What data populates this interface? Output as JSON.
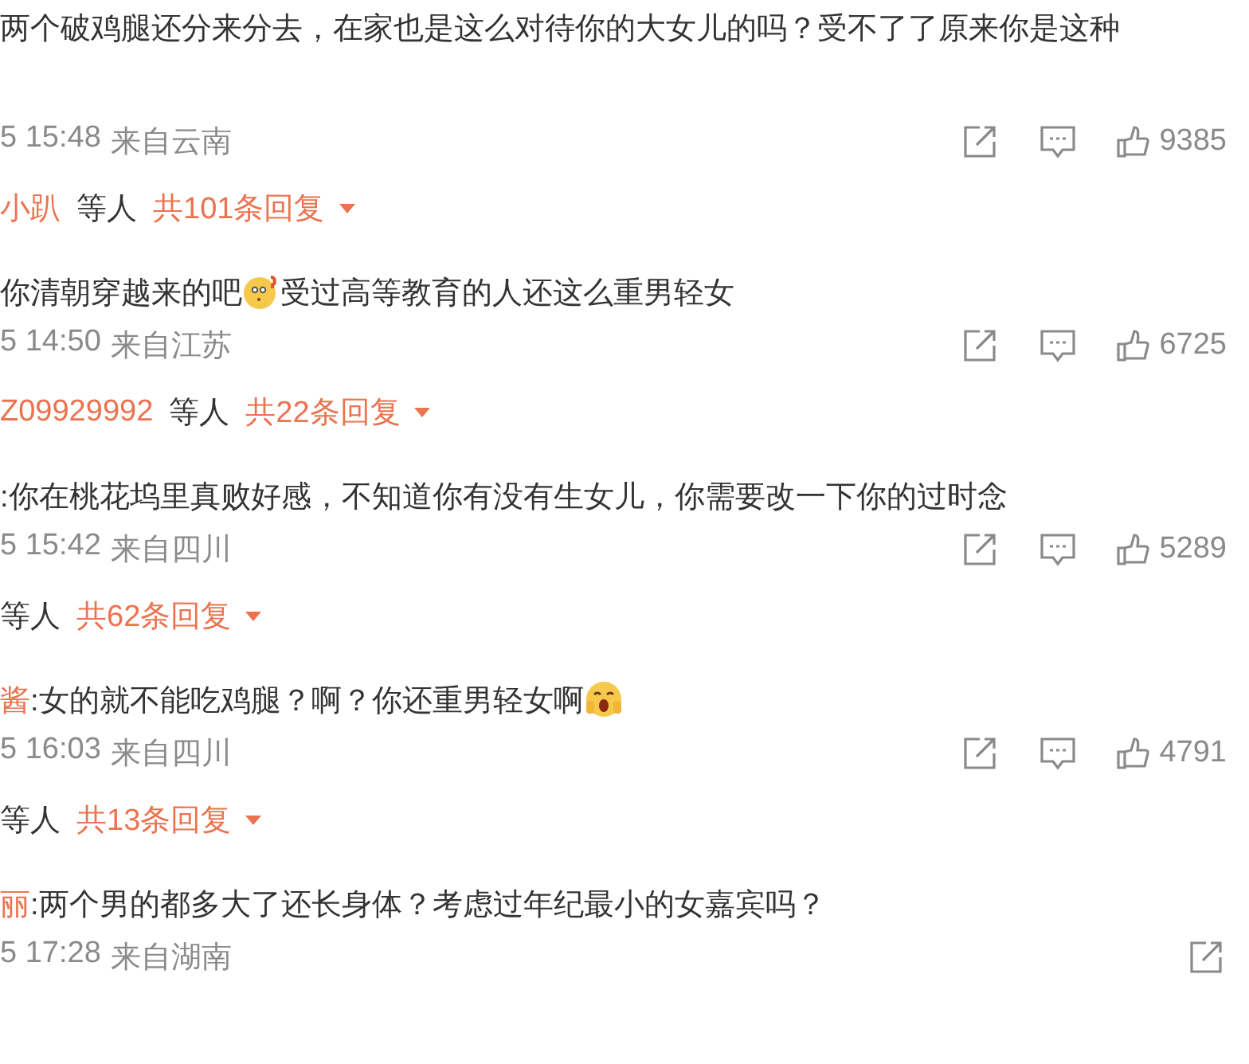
{
  "comments": [
    {
      "text": "两个破鸡腿还分来分去，在家也是这么对待你的大女儿的吗？受不了了原来你是这种",
      "time": "5 15:48",
      "location": "来自云南",
      "likes": "9385",
      "replies": {
        "name": "小趴",
        "label": "等人",
        "count": "共101条回复"
      }
    },
    {
      "text": "你清朝穿越来的吧",
      "emoji": {
        "kind": "confused"
      },
      "text_after": "受过高等教育的人还这么重男轻女",
      "time": "5 14:50",
      "location": "来自江苏",
      "likes": "6725",
      "replies": {
        "name": "Z09929992",
        "label": "等人",
        "count": "共22条回复"
      }
    },
    {
      "text": ":你在桃花坞里真败好感，不知道你有没有生女儿，你需要改一下你的过时念",
      "time": "5 15:42",
      "location": "来自四川",
      "likes": "5289",
      "replies": {
        "label": "等人",
        "count": "共62条回复"
      }
    },
    {
      "author": "酱",
      "text": ":女的就不能吃鸡腿？啊？你还重男轻女啊",
      "emoji": {
        "kind": "surprised"
      },
      "time": "5 16:03",
      "location": "来自四川",
      "likes": "4791",
      "replies": {
        "label": "等人",
        "count": "共13条回复"
      }
    },
    {
      "author": "丽",
      "text": ":两个男的都多大了还长身体？考虑过年纪最小的女嘉宾吗？",
      "time": "5 17:28",
      "location": "来自湖南"
    }
  ]
}
